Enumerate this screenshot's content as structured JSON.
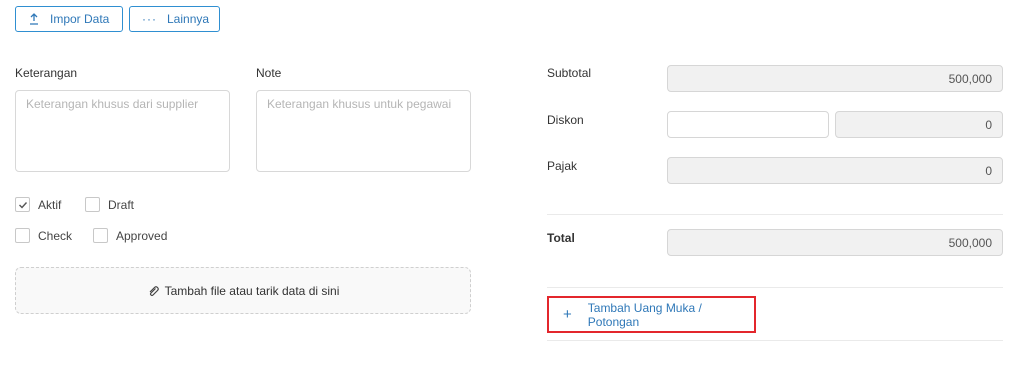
{
  "toolbar": {
    "import_label": "Impor Data",
    "more_label": "Lainnya"
  },
  "remarks": {
    "keterangan_label": "Keterangan",
    "keterangan_placeholder": "Keterangan khusus dari supplier",
    "note_label": "Note",
    "note_placeholder": "Keterangan khusus untuk pegawai"
  },
  "checkboxes": [
    {
      "label": "Aktif",
      "checked": true
    },
    {
      "label": "Draft",
      "checked": false
    },
    {
      "label": "Check",
      "checked": false
    },
    {
      "label": "Approved",
      "checked": false
    }
  ],
  "attachment": {
    "label": "Tambah file atau tarik data di sini"
  },
  "summary": {
    "subtotal_label": "Subtotal",
    "subtotal_value": "500,000",
    "diskon_label": "Diskon",
    "diskon_input": "",
    "diskon_value": "0",
    "pajak_label": "Pajak",
    "pajak_value": "0",
    "total_label": "Total",
    "total_value": "500,000"
  },
  "add_advance": {
    "label": "Tambah Uang Muka / Potongan",
    "highlight_color": "#e3262c"
  },
  "colors": {
    "accent": "#2f78b8"
  }
}
